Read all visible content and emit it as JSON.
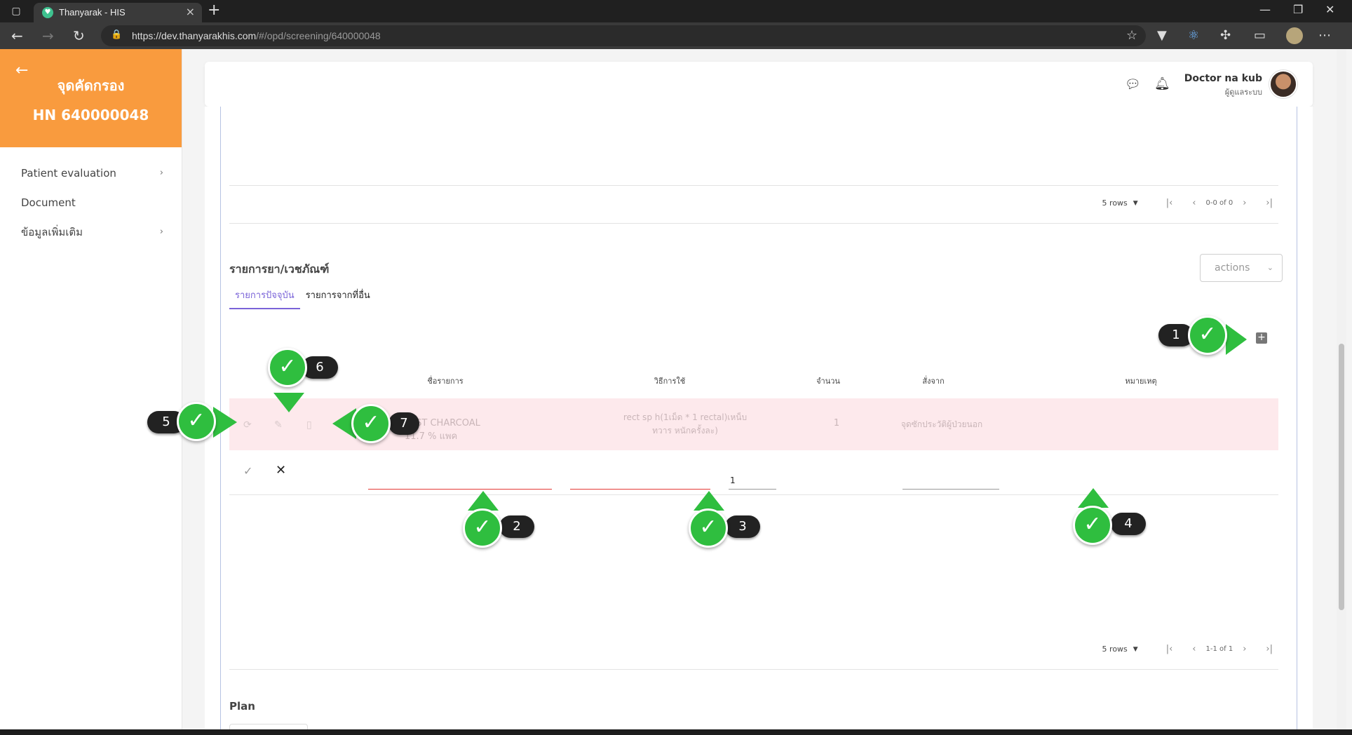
{
  "browser": {
    "tab_title": "Thanyarak - HIS",
    "url_host": "https://dev.thanyarakhis.com",
    "url_path": "/#/opd/screening/640000048"
  },
  "sidebar": {
    "title": "จุดคัดกรอง",
    "hn": "HN 640000048",
    "items": [
      {
        "label": "Patient evaluation",
        "has_chevron": true
      },
      {
        "label": "Document",
        "has_chevron": false
      },
      {
        "label": "ข้อมูลเพิ่มเติม",
        "has_chevron": true
      }
    ]
  },
  "header": {
    "user_name": "Doctor na kub",
    "user_role": "ผู้ดูแลระบบ"
  },
  "top_table": {
    "rows_label": "5 rows",
    "range": "0-0 of 0"
  },
  "medicine": {
    "title": "รายการยา/เวชภัณฑ์",
    "actions_label": "actions",
    "tabs": [
      {
        "label": "รายการปัจจุบัน",
        "active": true
      },
      {
        "label": "รายการจากที่อื่น",
        "active": false
      }
    ],
    "columns": [
      "ชื่อรายการ",
      "วิธีการใช้",
      "จำนวน",
      "สั่งจาก",
      "หมายเหตุ"
    ],
    "rows": [
      {
        "name": "TEST CHARCOAL 11.7 % แพค",
        "usage": "rect sp h(1เม็ด * 1 rectal)เหน็บทวาร หนักครั้งละ)",
        "qty": "1",
        "from": "จุดซักประวัติผู้ป่วยนอก",
        "note": ""
      }
    ],
    "edit_row": {
      "name": "",
      "usage": "",
      "qty": "1",
      "note": ""
    },
    "rows_label": "5 rows",
    "range": "1-1 of 1"
  },
  "plan": {
    "title": "Plan"
  },
  "annotations": [
    "1",
    "2",
    "3",
    "4",
    "5",
    "6",
    "7"
  ],
  "colors": {
    "sidebar_header": "#f99b3e",
    "active_tab": "#7a63d8",
    "marker_green": "#2fbe3f",
    "error_underline": "#e53935"
  }
}
